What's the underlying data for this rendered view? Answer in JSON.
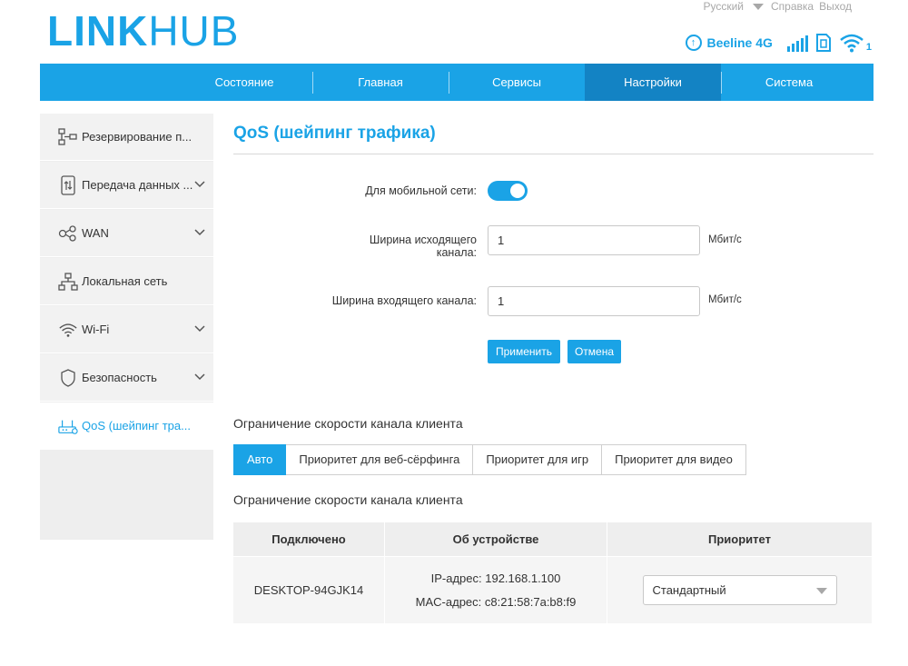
{
  "brand": {
    "part1": "LINK",
    "part2": "HUB"
  },
  "top_links": {
    "language": "Русский",
    "help": "Справка",
    "logout": "Выход"
  },
  "status": {
    "operator": "Beeline 4G",
    "wifi_clients": "1"
  },
  "nav": [
    "Состояние",
    "Главная",
    "Сервисы",
    "Настройки",
    "Система"
  ],
  "nav_active": "Настройки",
  "sidebar": [
    {
      "label": "Резервирование п...",
      "icon": "backup-icon",
      "chevron": false
    },
    {
      "label": "Передача данных ...",
      "icon": "phone-data-icon",
      "chevron": true
    },
    {
      "label": "WAN",
      "icon": "network-icon",
      "chevron": true
    },
    {
      "label": "Локальная сеть",
      "icon": "lan-icon",
      "chevron": false
    },
    {
      "label": "Wi-Fi",
      "icon": "wifi-icon",
      "chevron": true
    },
    {
      "label": "Безопасность",
      "icon": "shield-icon",
      "chevron": true
    },
    {
      "label": "QoS (шейпинг тра...",
      "icon": "router-icon",
      "chevron": false,
      "active": true
    }
  ],
  "page": {
    "title": "QoS (шейпинг трафика)"
  },
  "form": {
    "mobile_label": "Для мобильной сети:",
    "mobile_enabled": true,
    "upload_label_line1": "Ширина исходящего",
    "upload_label_line2": "канала:",
    "upload_value": "1",
    "download_label": "Ширина входящего канала:",
    "download_value": "1",
    "unit": "Мбит/с",
    "apply": "Применить",
    "cancel": "Отмена"
  },
  "client_limit": {
    "heading": "Ограничение скорости канала клиента",
    "tabs": [
      "Авто",
      "Приоритет для веб-сёрфинга",
      "Приоритет для игр",
      "Приоритет для видео"
    ],
    "active_tab": "Авто",
    "heading2": "Ограничение скорости канала клиента",
    "columns": [
      "Подключено",
      "Об устройстве",
      "Приоритет"
    ],
    "rows": [
      {
        "device": "DESKTOP-94GJK14",
        "ip": "IP-адрес: 192.168.1.100",
        "mac": "MAC-адрес: c8:21:58:7a:b8:f9",
        "priority": "Стандартный"
      }
    ]
  },
  "colors": {
    "accent": "#1aa3e6",
    "nav_active": "#1383c4"
  }
}
